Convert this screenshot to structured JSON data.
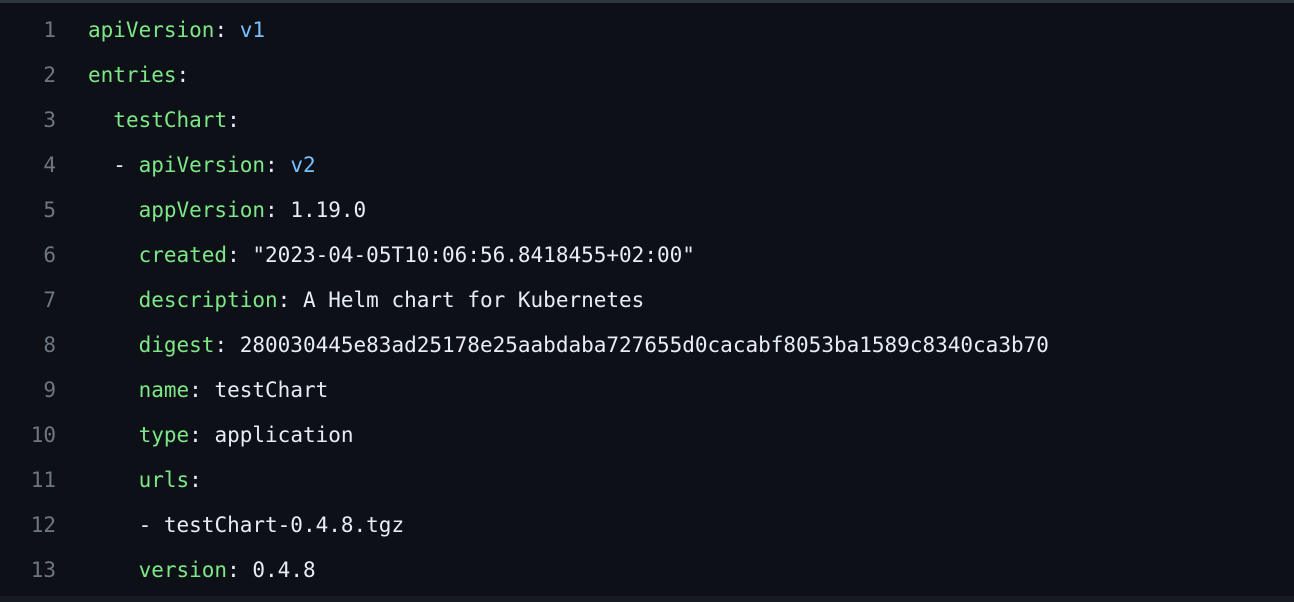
{
  "colors": {
    "background": "#0d1117",
    "line_number": "#6e7681",
    "key": "#7ee787",
    "text": "#e6edf3",
    "keyword_value": "#79c0ff"
  },
  "lines": [
    {
      "number": "1",
      "indent": "",
      "dash": "",
      "key": "apiVersion",
      "colon": ":",
      "value": " v1",
      "value_kw": true
    },
    {
      "number": "2",
      "indent": "",
      "dash": "",
      "key": "entries",
      "colon": ":",
      "value": "",
      "value_kw": false
    },
    {
      "number": "3",
      "indent": "  ",
      "dash": "",
      "key": "testChart",
      "colon": ":",
      "value": "",
      "value_kw": false
    },
    {
      "number": "4",
      "indent": "  ",
      "dash": "- ",
      "key": "apiVersion",
      "colon": ":",
      "value": " v2",
      "value_kw": true
    },
    {
      "number": "5",
      "indent": "    ",
      "dash": "",
      "key": "appVersion",
      "colon": ":",
      "value": " 1.19.0",
      "value_kw": false
    },
    {
      "number": "6",
      "indent": "    ",
      "dash": "",
      "key": "created",
      "colon": ":",
      "value": " \"2023-04-05T10:06:56.8418455+02:00\"",
      "value_kw": false
    },
    {
      "number": "7",
      "indent": "    ",
      "dash": "",
      "key": "description",
      "colon": ":",
      "value": " A Helm chart for Kubernetes",
      "value_kw": false
    },
    {
      "number": "8",
      "indent": "    ",
      "dash": "",
      "key": "digest",
      "colon": ":",
      "value": " 280030445e83ad25178e25aabdaba727655d0cacabf8053ba1589c8340ca3b70",
      "value_kw": false
    },
    {
      "number": "9",
      "indent": "    ",
      "dash": "",
      "key": "name",
      "colon": ":",
      "value": " testChart",
      "value_kw": false
    },
    {
      "number": "10",
      "indent": "    ",
      "dash": "",
      "key": "type",
      "colon": ":",
      "value": " application",
      "value_kw": false
    },
    {
      "number": "11",
      "indent": "    ",
      "dash": "",
      "key": "urls",
      "colon": ":",
      "value": "",
      "value_kw": false
    },
    {
      "number": "12",
      "indent": "    ",
      "dash": "- ",
      "key": "",
      "colon": "",
      "value": "testChart-0.4.8.tgz",
      "value_kw": false
    },
    {
      "number": "13",
      "indent": "    ",
      "dash": "",
      "key": "version",
      "colon": ":",
      "value": " 0.4.8",
      "value_kw": false
    }
  ]
}
